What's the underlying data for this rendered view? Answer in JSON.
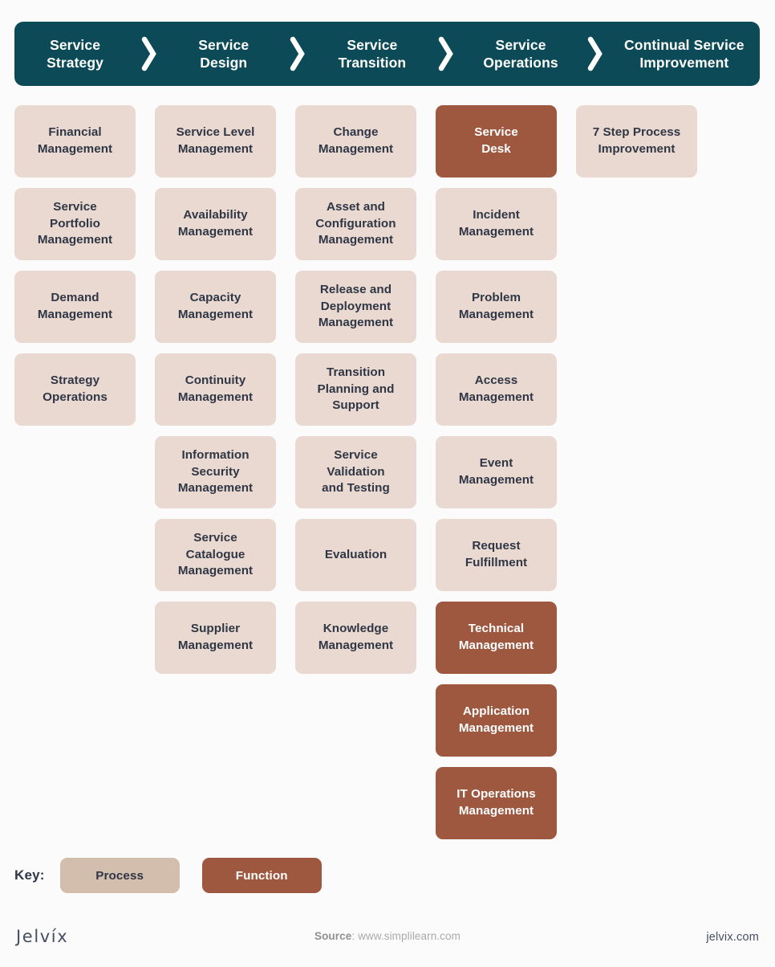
{
  "lifecycle": {
    "stages": [
      {
        "label": "Service\nStrategy"
      },
      {
        "label": "Service\nDesign"
      },
      {
        "label": "Service\nTransition"
      },
      {
        "label": "Service\nOperations"
      },
      {
        "label": "Continual Service\nImprovement"
      }
    ],
    "separator_icon": "chevron-right-icon",
    "bar_color": "#0d4a57",
    "text_color": "#ffffff"
  },
  "colors": {
    "process": "#ead9d0",
    "function": "#9e5840",
    "process_key": "#d3bdac",
    "card_text": "#2f3645",
    "function_text": "#ffffff",
    "background": "#fbfbfb"
  },
  "columns": [
    {
      "stage": "Service Strategy",
      "cards": [
        {
          "label": "Financial\nManagement",
          "type": "process"
        },
        {
          "label": "Service\nPortfolio\nManagement",
          "type": "process"
        },
        {
          "label": "Demand\nManagement",
          "type": "process"
        },
        {
          "label": "Strategy\nOperations",
          "type": "process"
        }
      ]
    },
    {
      "stage": "Service Design",
      "cards": [
        {
          "label": "Service Level\nManagement",
          "type": "process"
        },
        {
          "label": "Availability\nManagement",
          "type": "process"
        },
        {
          "label": "Capacity\nManagement",
          "type": "process"
        },
        {
          "label": "Continuity\nManagement",
          "type": "process"
        },
        {
          "label": "Information\nSecurity\nManagement",
          "type": "process"
        },
        {
          "label": "Service\nCatalogue\nManagement",
          "type": "process"
        },
        {
          "label": "Supplier\nManagement",
          "type": "process"
        }
      ]
    },
    {
      "stage": "Service Transition",
      "cards": [
        {
          "label": "Change\nManagement",
          "type": "process"
        },
        {
          "label": "Asset and\nConfiguration\nManagement",
          "type": "process"
        },
        {
          "label": "Release and\nDeployment\nManagement",
          "type": "process"
        },
        {
          "label": "Transition\nPlanning and\nSupport",
          "type": "process"
        },
        {
          "label": "Service\nValidation\nand Testing",
          "type": "process"
        },
        {
          "label": "Evaluation",
          "type": "process"
        },
        {
          "label": "Knowledge\nManagement",
          "type": "process"
        }
      ]
    },
    {
      "stage": "Service Operations",
      "cards": [
        {
          "label": "Service\nDesk",
          "type": "function"
        },
        {
          "label": "Incident\nManagement",
          "type": "process"
        },
        {
          "label": "Problem\nManagement",
          "type": "process"
        },
        {
          "label": "Access\nManagement",
          "type": "process"
        },
        {
          "label": "Event\nManagement",
          "type": "process"
        },
        {
          "label": "Request\nFulfillment",
          "type": "process"
        },
        {
          "label": "Technical\nManagement",
          "type": "function"
        },
        {
          "label": "Application\nManagement",
          "type": "function"
        },
        {
          "label": "IT Operations\nManagement",
          "type": "function"
        }
      ]
    },
    {
      "stage": "Continual Service Improvement",
      "cards": [
        {
          "label": "7 Step Process\nImprovement",
          "type": "process"
        }
      ]
    }
  ],
  "key": {
    "label": "Key:",
    "items": [
      {
        "label": "Process",
        "type": "process"
      },
      {
        "label": "Function",
        "type": "function"
      }
    ]
  },
  "footer": {
    "brand": "Jelvíx",
    "source_label": "Source",
    "source_separator": ": ",
    "source_value": "www.simplilearn.com",
    "site_url": "jelvix.com"
  }
}
